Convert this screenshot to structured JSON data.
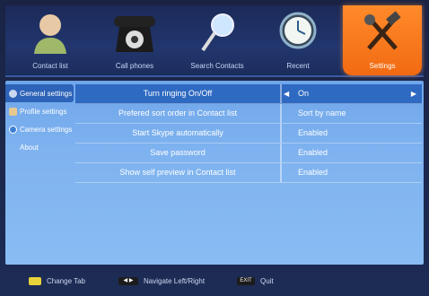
{
  "nav": {
    "tabs": [
      {
        "label": "Contact list",
        "icon": "contact-person-icon"
      },
      {
        "label": "Call phones",
        "icon": "telephone-icon"
      },
      {
        "label": "Search Contacts",
        "icon": "magnifier-icon"
      },
      {
        "label": "Recent",
        "icon": "clock-icon"
      },
      {
        "label": "Settings",
        "icon": "tools-icon"
      }
    ],
    "active_index": 4
  },
  "sidebar": {
    "items": [
      {
        "label": "General settings",
        "icon": "gear-icon",
        "selected": true
      },
      {
        "label": "Profile settings",
        "icon": "profile-icon"
      },
      {
        "label": "Camera settings",
        "icon": "camera-icon"
      },
      {
        "label": "About"
      }
    ]
  },
  "settings": {
    "rows": [
      {
        "name": "Turn ringing On/Off",
        "value": "On",
        "selected": true
      },
      {
        "name": "Prefered sort order in Contact list",
        "value": "Sort by name"
      },
      {
        "name": "Start Skype automatically",
        "value": "Enabled"
      },
      {
        "name": "Save password",
        "value": "Enabled"
      },
      {
        "name": "Show self preview in Contact list",
        "value": "Enabled"
      }
    ],
    "arrow_left": "◀",
    "arrow_right": "▶"
  },
  "footer": {
    "change_tab": "Change Tab",
    "navigate": "Navigate Left/Right",
    "exit_key": "EXIT",
    "quit": "Quit"
  },
  "colors": {
    "accent": "#f26a12",
    "selection": "#2f6ac2",
    "panel": "#7fb3f0",
    "key_yellow": "#e8d23a"
  }
}
